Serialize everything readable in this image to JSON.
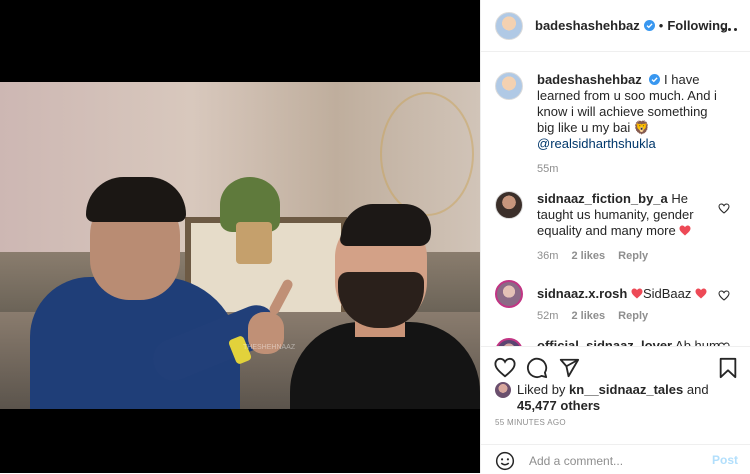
{
  "post": {
    "author": "badeshashehbaz",
    "follow_status": "Following",
    "separator": "•",
    "caption": {
      "username": "badeshashehbaz",
      "text": "I have learned from u soo much. And i know i will achieve something big like u my bai",
      "emoji": "🦁",
      "mention": "@realsidharthshukla",
      "time": "55m"
    },
    "comments": [
      {
        "username": "sidnaaz_fiction_by_a",
        "text": "He taught us humanity, gender equality and many more",
        "emoji": "❤",
        "time": "36m",
        "likes": "2 likes",
        "reply": "Reply"
      },
      {
        "username": "sidnaaz.x.rosh",
        "text_before": "",
        "text": "SidBaaz",
        "emoji": "❤",
        "time": "52m",
        "likes": "2 likes",
        "reply": "Reply"
      },
      {
        "username": "official_sidnaaz_lover",
        "text": "Ab hum Sidharth ko shehnaaz m dhundhv"
      }
    ],
    "liked_by": {
      "prefix": "Liked by",
      "user": "kn__sidnaaz_tales",
      "and": "and",
      "others": "45,477 others"
    },
    "timestamp": "55 MINUTES AGO",
    "add_comment": {
      "placeholder": "Add a comment...",
      "post_label": "Post"
    },
    "image_watermark": "THESHEHNAAZ"
  },
  "icons": {
    "verified": "verified-badge-icon",
    "more": "more-options-icon",
    "like": "heart-icon",
    "comment": "comment-icon",
    "share": "share-icon",
    "save": "bookmark-icon",
    "emoji": "smiley-icon"
  },
  "colors": {
    "verified": "#3897f0",
    "heart": "#ed4956",
    "mention": "#00376b",
    "muted": "#8e8e8e",
    "post_disabled": "#b2dffc"
  }
}
